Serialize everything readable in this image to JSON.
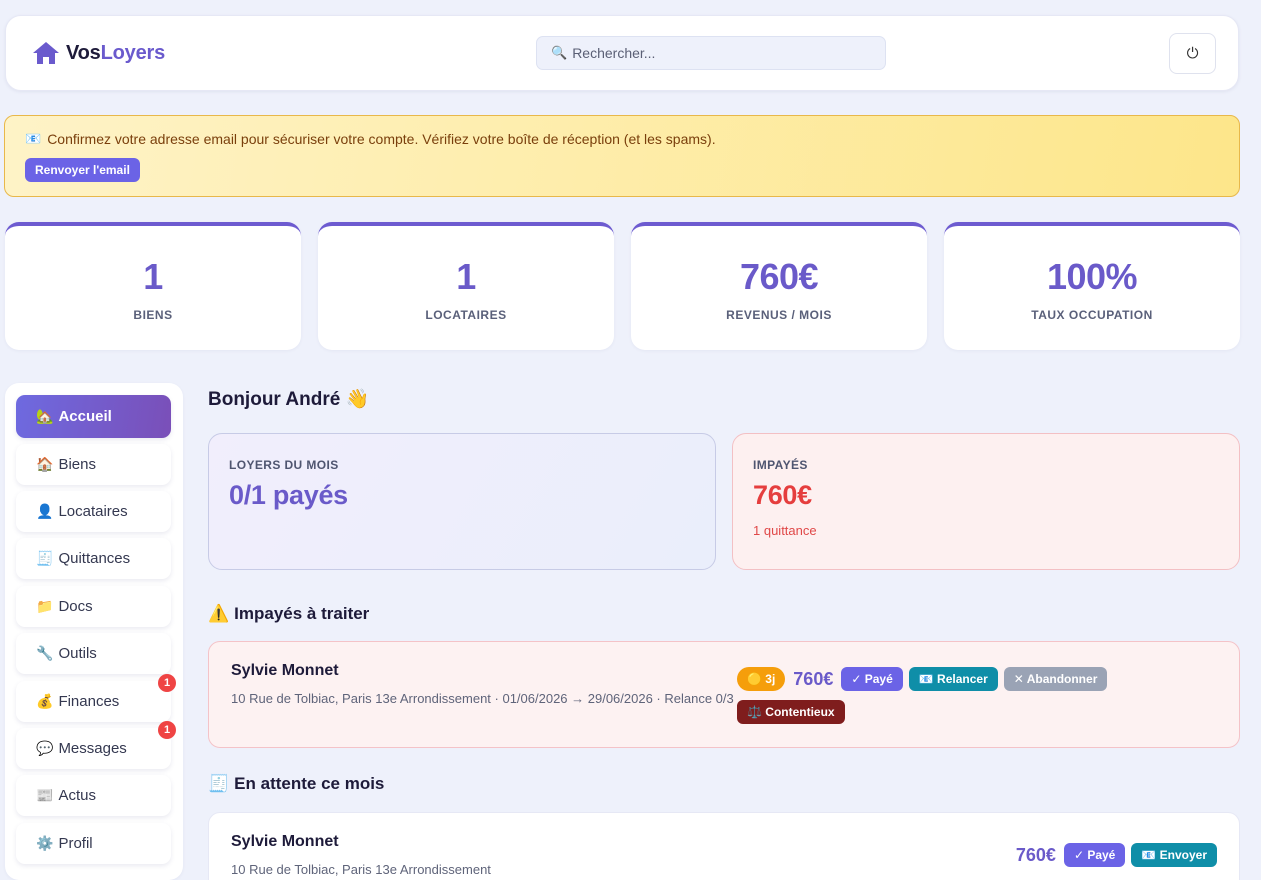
{
  "app": {
    "logo_part1": "Vos",
    "logo_part2": "Loyers",
    "search_placeholder": "Rechercher...",
    "power_icon": "⏻"
  },
  "banner": {
    "icon": "📧",
    "text": "Confirmez votre adresse email pour sécuriser votre compte. Vérifiez votre boîte de réception (et les spams).",
    "button": "Renvoyer l'email"
  },
  "stats": [
    {
      "value": "1",
      "label": "BIENS"
    },
    {
      "value": "1",
      "label": "LOCATAIRES"
    },
    {
      "value": "760€",
      "label": "REVENUS / MOIS"
    },
    {
      "value": "100%",
      "label": "TAUX OCCUPATION"
    }
  ],
  "sidebar": {
    "items": [
      {
        "icon": "🏡",
        "label": "Accueil",
        "badge": ""
      },
      {
        "icon": "🏠",
        "label": "Biens",
        "badge": ""
      },
      {
        "icon": "👤",
        "label": "Locataires",
        "badge": ""
      },
      {
        "icon": "🧾",
        "label": "Quittances",
        "badge": ""
      },
      {
        "icon": "📁",
        "label": "Docs",
        "badge": ""
      },
      {
        "icon": "🔧",
        "label": "Outils",
        "badge": ""
      },
      {
        "icon": "💰",
        "label": "Finances",
        "badge": "1"
      },
      {
        "icon": "💬",
        "label": "Messages",
        "badge": "1"
      },
      {
        "icon": "📰",
        "label": "Actus",
        "badge": ""
      },
      {
        "icon": "⚙️",
        "label": "Profil",
        "badge": ""
      }
    ]
  },
  "main": {
    "greeting": "Bonjour André 👋",
    "rent_card": {
      "label": "LOYERS DU MOIS",
      "value": "0/1 payés"
    },
    "unpaid_card": {
      "label": "IMPAYÉS",
      "value": "760€",
      "sub": "1 quittance"
    },
    "unpaid_section": {
      "icon": "⚠️",
      "title": "Impayés à traiter",
      "row": {
        "name": "Sylvie Monnet",
        "meta": "10 Rue de Tolbiac, Paris 13e Arrondissement · 01/06/2026 → 29/06/2026 · Relance 0/3",
        "days": "🟡 3j",
        "amount": "760€",
        "btn_paid": "✓ Payé",
        "btn_remind": "📧 Relancer",
        "btn_abandon": "✕ Abandonner",
        "btn_dispute": "⚖️ Contentieux"
      }
    },
    "pending_section": {
      "icon": "🧾",
      "title": "En attente ce mois",
      "row": {
        "name": "Sylvie Monnet",
        "meta": "10 Rue de Tolbiac, Paris 13e Arrondissement",
        "amount": "760€",
        "btn_paid": "✓ Payé",
        "btn_send": "📧 Envoyer"
      }
    }
  }
}
